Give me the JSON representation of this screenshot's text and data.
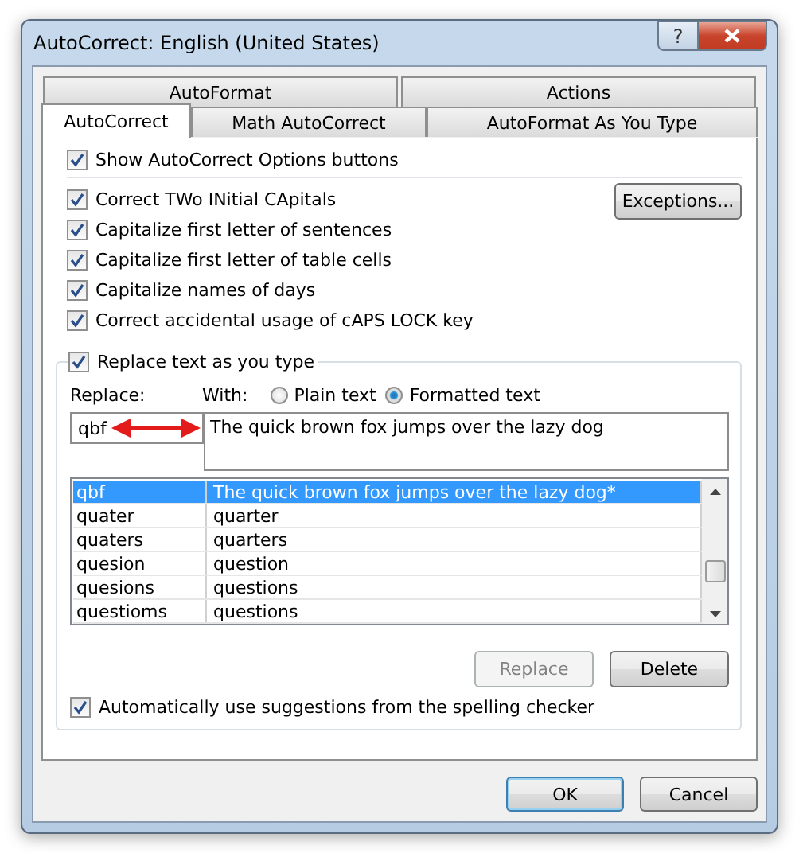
{
  "window": {
    "title": "AutoCorrect: English (United States)"
  },
  "title_buttons": [
    {
      "kind": "help",
      "label": "?"
    },
    {
      "kind": "close"
    }
  ],
  "tab_rows": [
    [
      {
        "label": "AutoFormat",
        "selected": false
      },
      {
        "label": "Actions",
        "selected": false
      }
    ],
    [
      {
        "label": "AutoCorrect",
        "selected": true
      },
      {
        "label": "Math AutoCorrect",
        "selected": false
      },
      {
        "label": "AutoFormat As You Type",
        "selected": false
      }
    ]
  ],
  "show_options": {
    "label": "Show AutoCorrect Options buttons",
    "checked": true
  },
  "options": [
    {
      "label": "Correct TWo INitial CApitals",
      "checked": true
    },
    {
      "label": "Capitalize first letter of sentences",
      "checked": true
    },
    {
      "label": "Capitalize first letter of table cells",
      "checked": true
    },
    {
      "label": "Capitalize names of days",
      "checked": true
    },
    {
      "label": "Correct accidental usage of cAPS LOCK key",
      "checked": true
    }
  ],
  "exceptions_button": "Exceptions...",
  "replace_group": {
    "label": "Replace text as you type",
    "checked": true
  },
  "replace_label": "Replace:",
  "with_label": "With:",
  "radios": [
    {
      "label": "Plain text",
      "selected": false
    },
    {
      "label": "Formatted text",
      "selected": true
    }
  ],
  "replace_value": "qbf",
  "with_value": "The quick brown fox jumps over the lazy dog",
  "table": {
    "rows": [
      {
        "replace": "qbf",
        "with": "The quick brown fox jumps over the lazy dog*",
        "selected": true
      },
      {
        "replace": "quater",
        "with": "quarter",
        "selected": false
      },
      {
        "replace": "quaters",
        "with": "quarters",
        "selected": false
      },
      {
        "replace": "quesion",
        "with": "question",
        "selected": false
      },
      {
        "replace": "quesions",
        "with": "questions",
        "selected": false
      },
      {
        "replace": "questioms",
        "with": "questions",
        "selected": false
      }
    ]
  },
  "list_buttons": [
    {
      "label": "Replace",
      "disabled": true
    },
    {
      "label": "Delete",
      "disabled": false
    }
  ],
  "spelling": {
    "label": "Automatically use suggestions from the spelling checker",
    "checked": true
  },
  "footer_buttons": [
    {
      "label": "OK",
      "default": true
    },
    {
      "label": "Cancel",
      "default": false
    }
  ]
}
